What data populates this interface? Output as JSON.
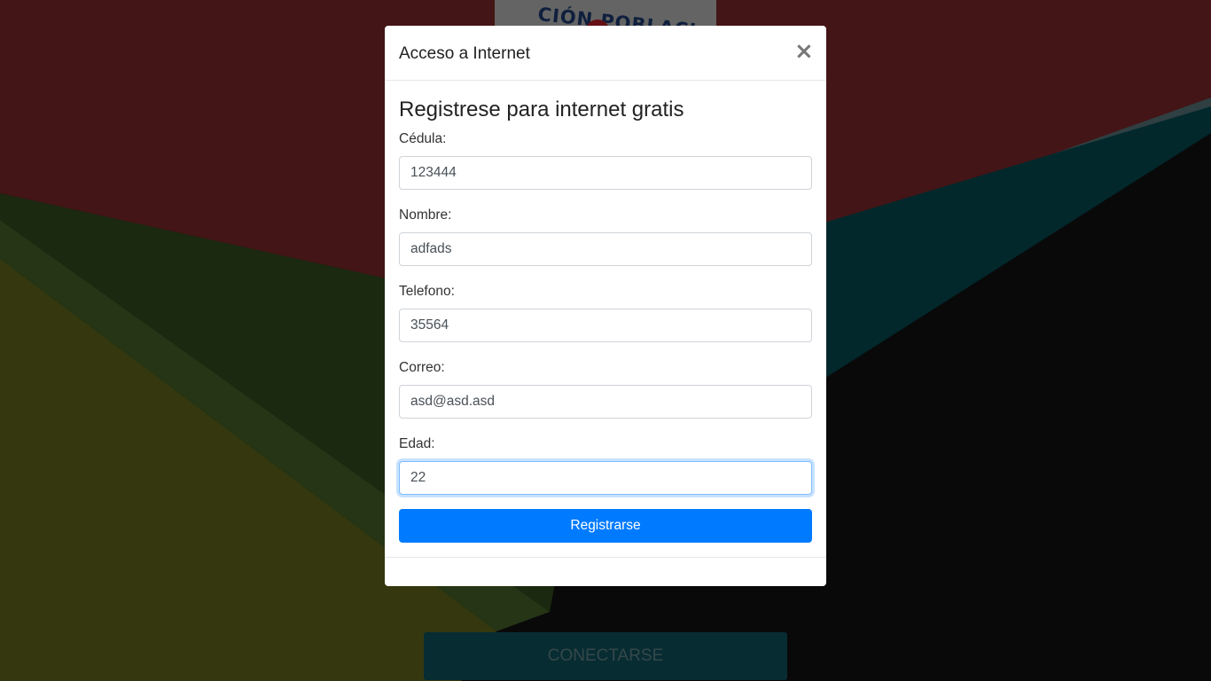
{
  "background": {
    "logo_text": "CIÓN POBLACI",
    "connect_button_label": "CONECTARSE"
  },
  "modal": {
    "title": "Acceso a Internet",
    "close_symbol": "×",
    "heading": "Registrese para internet gratis",
    "fields": [
      {
        "label": "Cédula:",
        "value": "123444"
      },
      {
        "label": "Nombre:",
        "value": "adfads"
      },
      {
        "label": "Telefono:",
        "value": "35564"
      },
      {
        "label": "Correo:",
        "value": "asd@asd.asd"
      },
      {
        "label": "Edad:",
        "value": "22"
      }
    ],
    "focused_field": "Edad:",
    "submit_label": "Registrarse"
  },
  "colors": {
    "primary_button": "#007bff",
    "focus_ring": "#80bdff",
    "connect_button": "#0f5964"
  },
  "icons": {
    "close": "close-icon"
  }
}
